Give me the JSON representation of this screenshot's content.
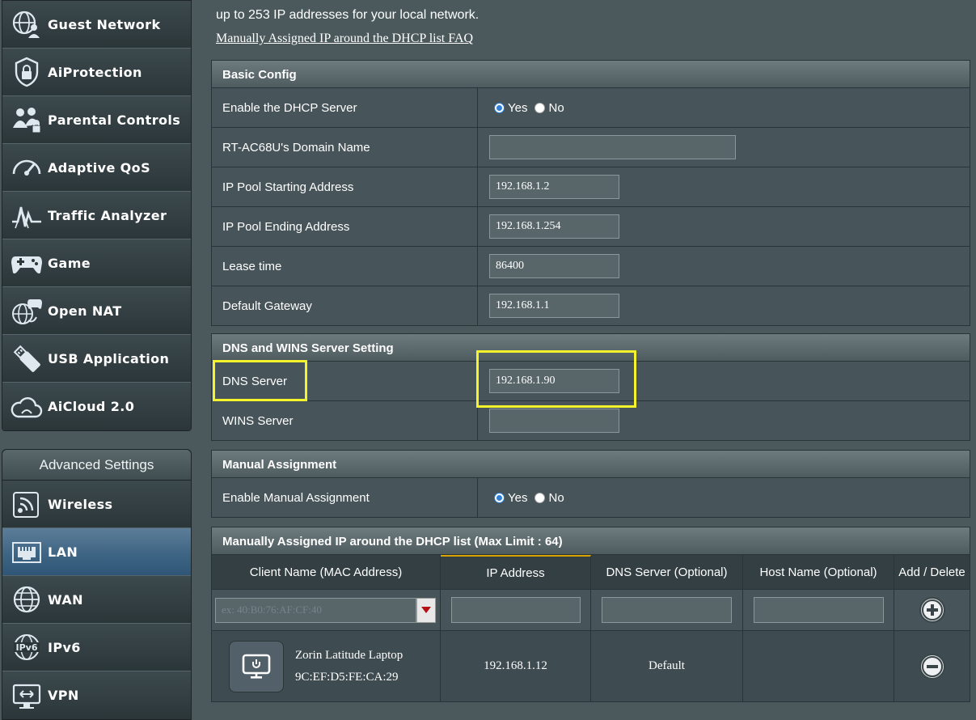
{
  "sidebar": {
    "top_items": [
      {
        "label": "Guest Network",
        "icon": "globe-people-icon"
      },
      {
        "label": "AiProtection",
        "icon": "shield-lock-icon"
      },
      {
        "label": "Parental Controls",
        "icon": "family-lock-icon"
      },
      {
        "label": "Adaptive QoS",
        "icon": "speedometer-icon"
      },
      {
        "label": "Traffic Analyzer",
        "icon": "traffic-wave-icon"
      },
      {
        "label": "Game",
        "icon": "gamepad-icon"
      },
      {
        "label": "Open NAT",
        "icon": "globe-gamepad-icon"
      },
      {
        "label": "USB Application",
        "icon": "usb-icon"
      },
      {
        "label": "AiCloud 2.0",
        "icon": "cloud-icon"
      }
    ],
    "advanced_header": "Advanced Settings",
    "advanced_items": [
      {
        "label": "Wireless",
        "icon": "wifi-icon"
      },
      {
        "label": "LAN",
        "icon": "lan-icon",
        "active": true
      },
      {
        "label": "WAN",
        "icon": "globe-icon"
      },
      {
        "label": "IPv6",
        "icon": "ipv6-globe-icon"
      },
      {
        "label": "VPN",
        "icon": "vpn-monitor-icon"
      }
    ]
  },
  "intro_text": "up to 253 IP addresses for your local network.",
  "faq_link": "Manually Assigned IP around the DHCP list FAQ",
  "basic_config": {
    "title": "Basic Config",
    "enable_dhcp_label": "Enable the DHCP Server",
    "yes": "Yes",
    "no": "No",
    "domain_label": "RT-AC68U's Domain Name",
    "domain_value": "",
    "pool_start_label": "IP Pool Starting Address",
    "pool_start_value": "192.168.1.2",
    "pool_end_label": "IP Pool Ending Address",
    "pool_end_value": "192.168.1.254",
    "lease_label": "Lease time",
    "lease_value": "86400",
    "gateway_label": "Default Gateway",
    "gateway_value": "192.168.1.1"
  },
  "dns_wins": {
    "title": "DNS and WINS Server Setting",
    "dns_label": "DNS Server",
    "dns_value": "192.168.1.90",
    "wins_label": "WINS Server",
    "wins_value": ""
  },
  "manual": {
    "title": "Manual Assignment",
    "enable_label": "Enable Manual Assignment",
    "yes": "Yes",
    "no": "No"
  },
  "assigned_list": {
    "title": "Manually Assigned IP around the DHCP list (Max Limit : 64)",
    "headers": [
      "Client Name (MAC Address)",
      "IP Address",
      "DNS Server (Optional)",
      "Host Name (Optional)",
      "Add / Delete"
    ],
    "mac_placeholder": "ex: 40:B0:76:AF:CF:40",
    "entry": {
      "client_name": "Zorin Latitude Laptop",
      "mac": "9C:EF:D5:FE:CA:29",
      "ip": "192.168.1.12",
      "dns": "Default",
      "host": ""
    }
  },
  "colors": {
    "highlight": "#f4f32c",
    "active_menu": "#3f6584",
    "tab_accent": "#d9a300"
  }
}
